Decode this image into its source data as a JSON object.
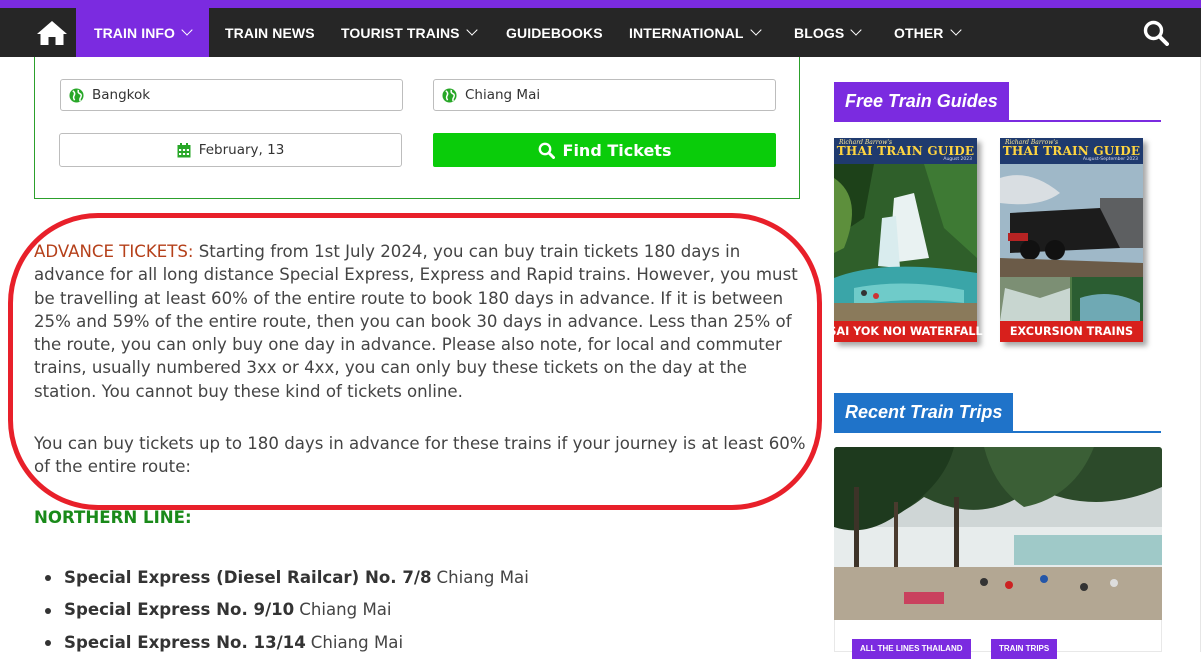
{
  "nav": {
    "items": [
      {
        "label": "TRAIN INFO",
        "dropdown": true,
        "active": true
      },
      {
        "label": "TRAIN NEWS",
        "dropdown": false
      },
      {
        "label": "TOURIST TRAINS",
        "dropdown": true
      },
      {
        "label": "GUIDEBOOKS",
        "dropdown": false
      },
      {
        "label": "INTERNATIONAL",
        "dropdown": true
      },
      {
        "label": "BLOGS",
        "dropdown": true
      },
      {
        "label": "OTHER",
        "dropdown": true
      }
    ],
    "icons": [
      "home-icon",
      "search-icon"
    ],
    "accent_color": "#7b2be0",
    "bar_color": "#262626"
  },
  "booking": {
    "from_value": "Bangkok",
    "to_value": "Chiang Mai",
    "date_value": "February, 13",
    "find_label": "Find Tickets",
    "find_color": "#0acc0a"
  },
  "article": {
    "advance_label": "ADVANCE TICKETS:",
    "advance_text": " Starting from 1st July 2024, you can buy train tickets 180 days in advance for all long distance Special Express, Express and Rapid trains. However, you must be travelling at least 60% of the entire route to book 180 days in advance. If it is between 25% and 59% of the entire route, then you can book 30 days in advance. Less than 25% of the route, you can only buy one day in advance. Please also note, for local and commuter trains, usually numbered 3xx or 4xx, you can only buy these tickets on the day at the station. You cannot buy these kind of tickets online.",
    "para2": "You can buy tickets up to 180 days in advance for these trains if your journey is at least 60% of the entire route:",
    "section_heading": "NORTHERN LINE:",
    "trains": [
      {
        "name": "Special Express (Diesel Railcar) No. 7/8",
        "dest": "Chiang Mai"
      },
      {
        "name": "Special Express No. 9/10",
        "dest": "Chiang Mai"
      },
      {
        "name": "Special Express No. 13/14",
        "dest": "Chiang Mai"
      }
    ]
  },
  "sidebar": {
    "guides_heading": "Free Train Guides",
    "guides": [
      {
        "author": "Richard Barrow's",
        "title": "THAI TRAIN GUIDE",
        "date": "August 2023",
        "caption": "SAI YOK NOI WATERFALL"
      },
      {
        "author": "Richard Barrow's",
        "title": "THAI TRAIN GUIDE",
        "date": "August-September 2023",
        "caption": "EXCURSION TRAINS"
      }
    ],
    "trips_heading": "Recent Train Trips",
    "trip_tags": [
      "ALL THE LINES THAILAND",
      "TRAIN TRIPS"
    ]
  }
}
